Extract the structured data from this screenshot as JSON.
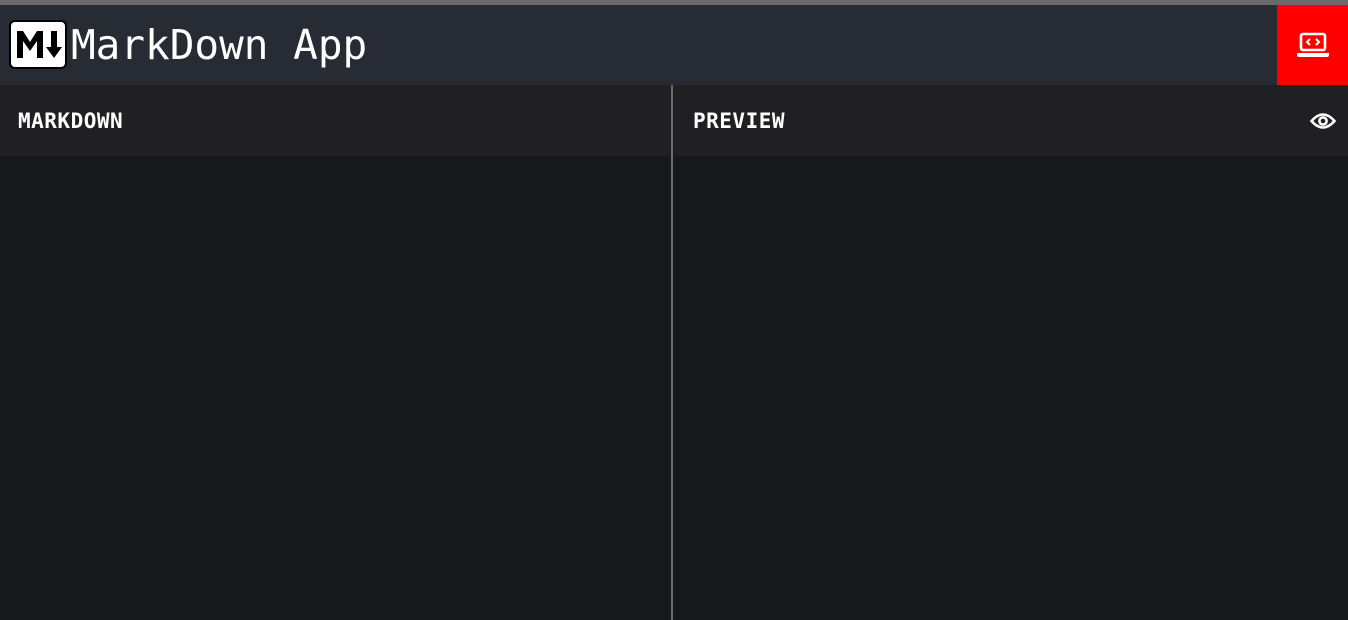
{
  "app": {
    "title": "MarkDown App",
    "logo_icon": "markdown-logo-icon",
    "action_icon": "laptop-code-icon",
    "colors": {
      "header_bg": "#272b34",
      "accent": "#ff0000",
      "pane_header_bg": "#202024",
      "pane_bg": "#17181b",
      "text": "#ffffff"
    }
  },
  "editor": {
    "title": "MARKDOWN",
    "content": ""
  },
  "preview": {
    "title": "PREVIEW",
    "toggle_icon": "eye-icon"
  }
}
